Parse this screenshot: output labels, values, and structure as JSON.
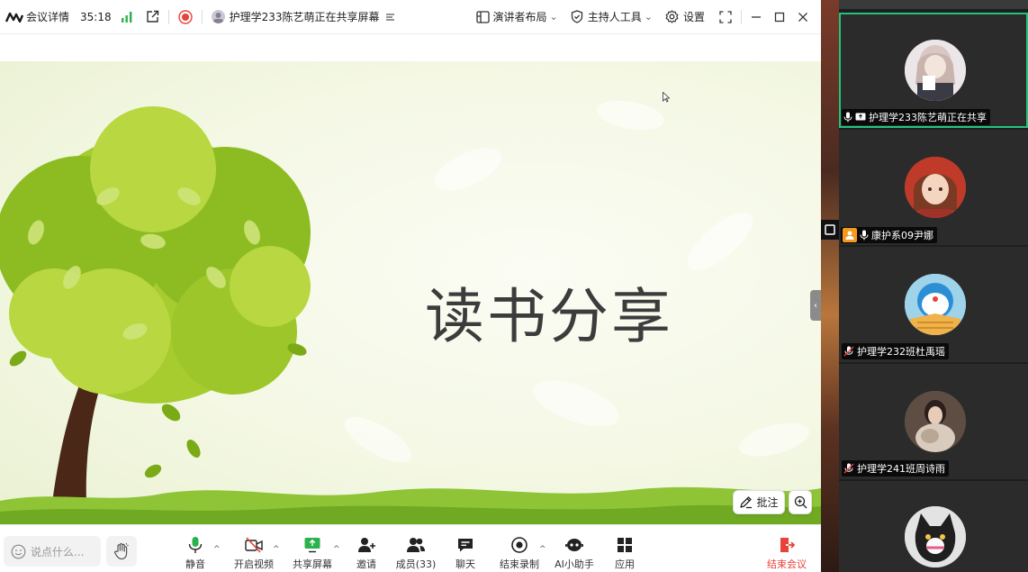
{
  "topbar": {
    "meeting_details": "会议详情",
    "timer": "35:18",
    "sharing_text": "护理学233陈艺萌正在共享屏幕",
    "speaker_layout": "演讲者布局",
    "host_tools": "主持人工具",
    "settings": "设置"
  },
  "slide": {
    "title": "读书分享"
  },
  "float": {
    "annotate": "批注"
  },
  "toolbar": {
    "chat_placeholder": "说点什么...",
    "mute": "静音",
    "video": "开启视频",
    "share": "共享屏幕",
    "invite": "邀请",
    "members": "成员(33)",
    "chat": "聊天",
    "stop_record": "结束录制",
    "ai": "AI小助手",
    "apps": "应用",
    "end": "结束会议"
  },
  "participants": [
    {
      "name": "护理学233陈艺萌正在共享"
    },
    {
      "name": "康护系09尹娜"
    },
    {
      "name": "护理学232班杜禹瑶"
    },
    {
      "name": "护理学241班周诗雨"
    }
  ],
  "colors": {
    "accent_green": "#21c47a",
    "record_red": "#e8423a",
    "end_red": "#e8423a",
    "signal_green": "#2bb24c"
  }
}
